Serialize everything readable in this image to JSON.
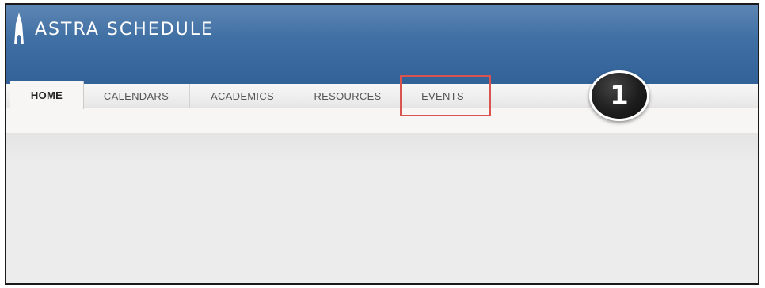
{
  "app": {
    "title": "ASTRA SCHEDULE"
  },
  "tabs": [
    {
      "label": "HOME",
      "active": true
    },
    {
      "label": "CALENDARS",
      "active": false
    },
    {
      "label": "ACADEMICS",
      "active": false
    },
    {
      "label": "RESOURCES",
      "active": false
    },
    {
      "label": "EVENTS",
      "active": false
    }
  ],
  "annotation": {
    "step_number": "1",
    "highlight_color": "#d9534f"
  },
  "colors": {
    "header_top": "#5d86b4",
    "header_bottom": "#2f5f95"
  },
  "icons": {
    "logo": "astra-tower-icon"
  }
}
